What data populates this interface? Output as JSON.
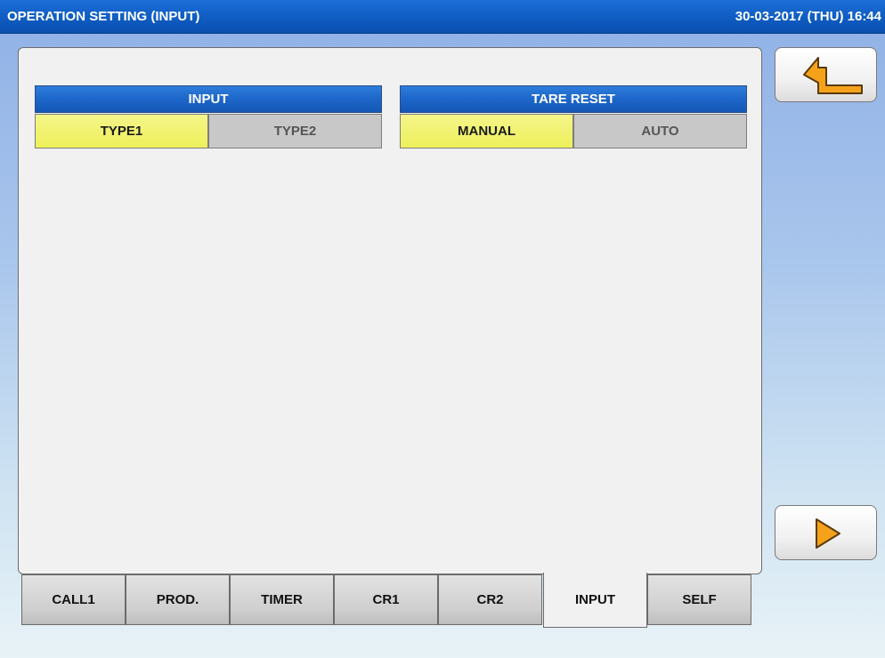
{
  "titlebar": {
    "title": "OPERATION SETTING (INPUT)",
    "datetime": "30-03-2017 (THU) 16:44"
  },
  "groups": {
    "input": {
      "header": "INPUT",
      "options": [
        {
          "label": "TYPE1",
          "selected": true
        },
        {
          "label": "TYPE2",
          "selected": false
        }
      ]
    },
    "tare_reset": {
      "header": "TARE RESET",
      "options": [
        {
          "label": "MANUAL",
          "selected": true
        },
        {
          "label": "AUTO",
          "selected": false
        }
      ]
    }
  },
  "side_buttons": {
    "back_icon": "return-arrow-icon",
    "next_icon": "play-triangle-icon"
  },
  "tabs": [
    {
      "label": "CALL1",
      "active": false
    },
    {
      "label": "PROD.",
      "active": false
    },
    {
      "label": "TIMER",
      "active": false
    },
    {
      "label": "CR1",
      "active": false
    },
    {
      "label": "CR2",
      "active": false
    },
    {
      "label": "INPUT",
      "active": true
    },
    {
      "label": "SELF",
      "active": false
    }
  ],
  "colors": {
    "titlebar": "#0f5cc2",
    "group_header": "#1d66c9",
    "selected_option": "#eef05a",
    "unselected_option": "#c8c8c8",
    "icon_orange": "#f5a21a"
  }
}
